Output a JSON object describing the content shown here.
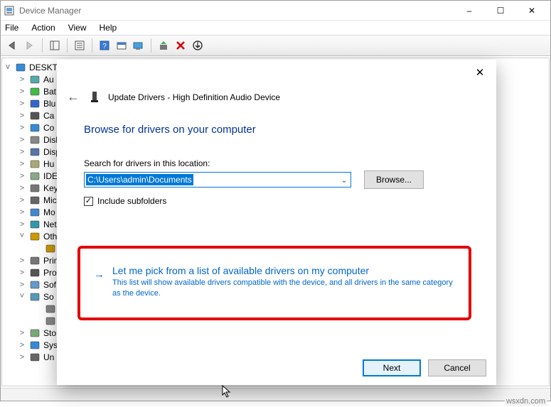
{
  "window": {
    "title": "Device Manager",
    "win_controls": {
      "min": "–",
      "max": "☐",
      "close": "✕"
    }
  },
  "menubar": [
    "File",
    "Action",
    "View",
    "Help"
  ],
  "tree": {
    "root": "DESKTOP",
    "items": [
      {
        "label": "Au",
        "exp": ">",
        "icon": "audio-icon"
      },
      {
        "label": "Bat",
        "exp": ">",
        "icon": "battery-icon"
      },
      {
        "label": "Blu",
        "exp": ">",
        "icon": "bluetooth-icon"
      },
      {
        "label": "Ca",
        "exp": ">",
        "icon": "camera-icon"
      },
      {
        "label": "Co",
        "exp": ">",
        "icon": "computer-icon"
      },
      {
        "label": "Disk",
        "exp": ">",
        "icon": "disk-icon"
      },
      {
        "label": "Disp",
        "exp": ">",
        "icon": "display-icon"
      },
      {
        "label": "Hu",
        "exp": ">",
        "icon": "hid-icon"
      },
      {
        "label": "IDE",
        "exp": ">",
        "icon": "ide-icon"
      },
      {
        "label": "Key",
        "exp": ">",
        "icon": "keyboard-icon"
      },
      {
        "label": "Mic",
        "exp": ">",
        "icon": "mouse-icon"
      },
      {
        "label": "Mo",
        "exp": ">",
        "icon": "monitor-icon"
      },
      {
        "label": "Net",
        "exp": ">",
        "icon": "network-icon"
      },
      {
        "label": "Oth",
        "exp": "v",
        "icon": "other-icon"
      },
      {
        "label": "",
        "exp": "",
        "icon": "unknown-device-icon",
        "grand": true
      },
      {
        "label": "Prin",
        "exp": ">",
        "icon": "print-icon"
      },
      {
        "label": "Pro",
        "exp": ">",
        "icon": "processor-icon"
      },
      {
        "label": "Sof",
        "exp": ">",
        "icon": "software-icon"
      },
      {
        "label": "So",
        "exp": "v",
        "icon": "sound-icon"
      },
      {
        "label": "",
        "exp": "",
        "icon": "speaker-icon",
        "grand": true
      },
      {
        "label": "",
        "exp": "",
        "icon": "speaker-icon",
        "grand": true
      },
      {
        "label": "Sto",
        "exp": ">",
        "icon": "storage-icon"
      },
      {
        "label": "Sys",
        "exp": ">",
        "icon": "system-icon"
      },
      {
        "label": "Un",
        "exp": ">",
        "icon": "usb-icon"
      }
    ]
  },
  "dialog": {
    "header": "Update Drivers - High Definition Audio Device",
    "title": "Browse for drivers on your computer",
    "location_label": "Search for drivers in this location:",
    "path_value": "C:\\Users\\admin\\Documents",
    "browse": "Browse...",
    "include_subfolders": "Include subfolders",
    "include_subfolders_checked": true,
    "option_title": "Let me pick from a list of available drivers on my computer",
    "option_desc": "This list will show available drivers compatible with the device, and all drivers in the same category as the device.",
    "next": "Next",
    "cancel": "Cancel",
    "close": "✕"
  },
  "watermark": "wsxdn.com"
}
